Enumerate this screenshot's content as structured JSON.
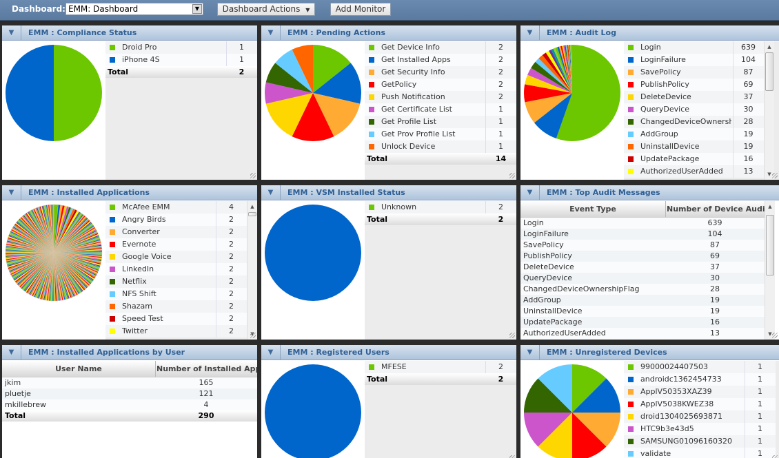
{
  "topbar": {
    "dashboard_label": "Dashboard:",
    "dashboard_value": "EMM: Dashboard",
    "actions_label": "Dashboard Actions",
    "add_monitor_label": "Add Monitor"
  },
  "palette": [
    "#6cc700",
    "#0066cc",
    "#ffaa33",
    "#ff0000",
    "#ffd700",
    "#cc55cc",
    "#336600",
    "#66ccff",
    "#ff6600",
    "#cc0000",
    "#ffff00",
    "#663399",
    "#009999",
    "#99cc33"
  ],
  "panels": {
    "compliance": {
      "title": "EMM : Compliance Status",
      "items": [
        {
          "label": "Droid Pro",
          "value": 1
        },
        {
          "label": "iPhone 4S",
          "value": 1
        }
      ],
      "total_label": "Total",
      "total": 2
    },
    "pending": {
      "title": "EMM : Pending Actions",
      "items": [
        {
          "label": "Get Device Info",
          "value": 2
        },
        {
          "label": "Get Installed Apps",
          "value": 2
        },
        {
          "label": "Get Security Info",
          "value": 2
        },
        {
          "label": "GetPolicy",
          "value": 2
        },
        {
          "label": "Push Notification",
          "value": 2
        },
        {
          "label": "Get Certificate List",
          "value": 1
        },
        {
          "label": "Get Profile List",
          "value": 1
        },
        {
          "label": "Get Prov Profile List",
          "value": 1
        },
        {
          "label": "Unlock Device",
          "value": 1
        }
      ],
      "total_label": "Total",
      "total": 14
    },
    "audit": {
      "title": "EMM : Audit Log",
      "items": [
        {
          "label": "Login",
          "value": 639
        },
        {
          "label": "LoginFailure",
          "value": 104
        },
        {
          "label": "SavePolicy",
          "value": 87
        },
        {
          "label": "PublishPolicy",
          "value": 69
        },
        {
          "label": "DeleteDevice",
          "value": 37
        },
        {
          "label": "QueryDevice",
          "value": 30
        },
        {
          "label": "ChangedDeviceOwnershi",
          "value": 28
        },
        {
          "label": "AddGroup",
          "value": 19
        },
        {
          "label": "UninstallDevice",
          "value": 19
        },
        {
          "label": "UpdatePackage",
          "value": 16
        },
        {
          "label": "AuthorizedUserAdded",
          "value": 13
        }
      ],
      "extra_small_slices": [
        10,
        9,
        8,
        8,
        7,
        6,
        6,
        5,
        5,
        4,
        4,
        3,
        3,
        3,
        2,
        2,
        2,
        2,
        1,
        1,
        1,
        1
      ]
    },
    "installed": {
      "title": "EMM : Installed Applications",
      "items": [
        {
          "label": "McAfee EMM",
          "value": 4
        },
        {
          "label": "Angry Birds",
          "value": 2
        },
        {
          "label": "Converter",
          "value": 2
        },
        {
          "label": "Evernote",
          "value": 2
        },
        {
          "label": "Google Voice",
          "value": 2
        },
        {
          "label": "LinkedIn",
          "value": 2
        },
        {
          "label": "Netflix",
          "value": 2
        },
        {
          "label": "NFS Shift",
          "value": 2
        },
        {
          "label": "Shazam",
          "value": 2
        },
        {
          "label": "Speed Test",
          "value": 2
        },
        {
          "label": "Twitter",
          "value": 2
        }
      ],
      "slice_count_total": 260
    },
    "vsm": {
      "title": "EMM : VSM Installed Status",
      "items": [
        {
          "label": "Unknown",
          "value": 2
        }
      ],
      "total_label": "Total",
      "total": 2
    },
    "top_audit": {
      "title": "EMM : Top Audit Messages",
      "columns": [
        "Event Type",
        "Number of Device Audit"
      ],
      "rows": [
        [
          "Login",
          "639"
        ],
        [
          "LoginFailure",
          "104"
        ],
        [
          "SavePolicy",
          "87"
        ],
        [
          "PublishPolicy",
          "69"
        ],
        [
          "DeleteDevice",
          "37"
        ],
        [
          "QueryDevice",
          "30"
        ],
        [
          "ChangedDeviceOwnershipFlag",
          "28"
        ],
        [
          "AddGroup",
          "19"
        ],
        [
          "UninstallDevice",
          "19"
        ],
        [
          "UpdatePackage",
          "16"
        ],
        [
          "AuthorizedUserAdded",
          "13"
        ]
      ]
    },
    "apps_by_user": {
      "title": "EMM : Installed Applications by User",
      "columns": [
        "User Name",
        "Number of Installed Appli"
      ],
      "rows": [
        [
          "jkim",
          "165"
        ],
        [
          "pluetje",
          "121"
        ],
        [
          "mkillebrew",
          "4"
        ]
      ],
      "total_label": "Total",
      "total": "290"
    },
    "registered": {
      "title": "EMM : Registered Users",
      "items": [
        {
          "label": "MFESE",
          "value": 2
        }
      ],
      "total_label": "Total",
      "total": 2
    },
    "unregistered": {
      "title": "EMM : Unregistered Devices",
      "items": [
        {
          "label": "99000024407503",
          "value": 1
        },
        {
          "label": "androidc1362454733",
          "value": 1
        },
        {
          "label": "ApplV50353XAZ39",
          "value": 1
        },
        {
          "label": "ApplV5038KWEZ38",
          "value": 1
        },
        {
          "label": "droid1304025693871",
          "value": 1
        },
        {
          "label": "HTC9b3e43d5",
          "value": 1
        },
        {
          "label": "SAMSUNG01096160320",
          "value": 1
        },
        {
          "label": "validate",
          "value": 1
        }
      ]
    }
  }
}
